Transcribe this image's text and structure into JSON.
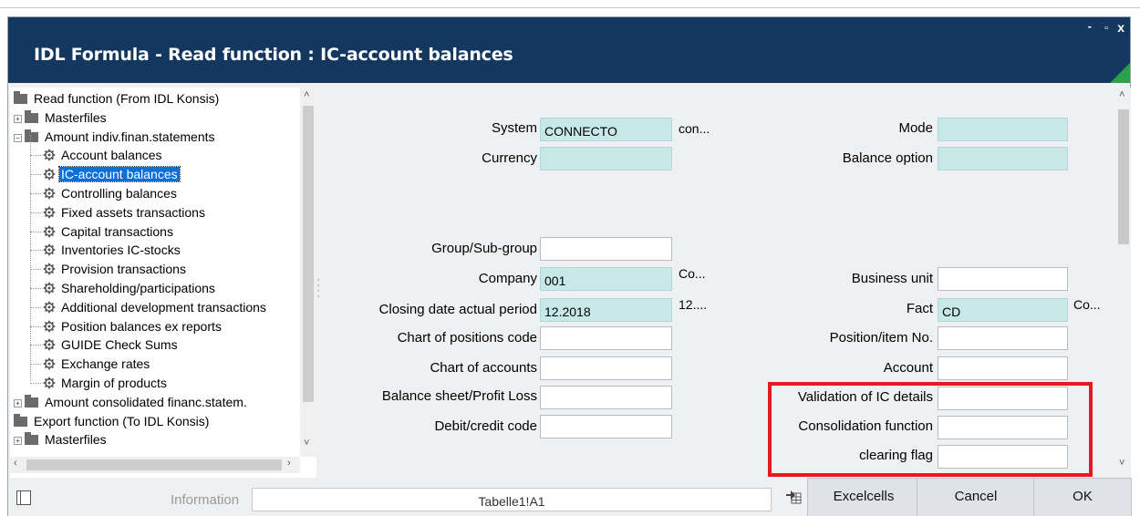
{
  "window": {
    "title": "IDL Formula  - Read function : IC-account balances",
    "controls": {
      "minimize": "-",
      "maximize": "▫",
      "close": "x"
    }
  },
  "tree": {
    "items": [
      {
        "label": "Read function (From IDL Konsis)",
        "kind": "folder",
        "expander": ""
      },
      {
        "label": "Masterfiles",
        "kind": "folder",
        "expander": "+"
      },
      {
        "label": "Amount indiv.finan.statements",
        "kind": "folder",
        "expander": "−"
      },
      {
        "label": "Account balances",
        "kind": "function"
      },
      {
        "label": "IC-account balances",
        "kind": "function",
        "selected": true
      },
      {
        "label": "Controlling balances",
        "kind": "function"
      },
      {
        "label": "Fixed assets transactions",
        "kind": "function"
      },
      {
        "label": "Capital transactions",
        "kind": "function"
      },
      {
        "label": "Inventories IC-stocks",
        "kind": "function"
      },
      {
        "label": "Provision transactions",
        "kind": "function"
      },
      {
        "label": "Shareholding/participations",
        "kind": "function"
      },
      {
        "label": "Additional development transactions",
        "kind": "function"
      },
      {
        "label": "Position balances ex reports",
        "kind": "function"
      },
      {
        "label": "GUIDE Check Sums",
        "kind": "function"
      },
      {
        "label": "Exchange rates",
        "kind": "function"
      },
      {
        "label": "Margin of products",
        "kind": "function"
      },
      {
        "label": "Amount consolidated financ.statem.",
        "kind": "folder",
        "expander": "+"
      },
      {
        "label": "Export function (To IDL Konsis)",
        "kind": "folder",
        "expander": ""
      },
      {
        "label": "Masterfiles",
        "kind": "folder",
        "expander": "+"
      }
    ]
  },
  "form": {
    "system": {
      "label": "System",
      "value": "CONNECTO",
      "desc": "con..."
    },
    "currency": {
      "label": "Currency",
      "value": ""
    },
    "mode": {
      "label": "Mode",
      "value": ""
    },
    "balance_option": {
      "label": "Balance option",
      "value": ""
    },
    "group": {
      "label": "Group/Sub-group",
      "value": ""
    },
    "company": {
      "label": "Company",
      "value": "001",
      "desc": "Co..."
    },
    "business_unit": {
      "label": "Business unit",
      "value": ""
    },
    "closing_date": {
      "label": "Closing date actual period",
      "value": "12.2018",
      "desc": "12...."
    },
    "fact": {
      "label": "Fact",
      "value": "CD",
      "desc": "Co..."
    },
    "chart_positions": {
      "label": "Chart of positions code",
      "value": ""
    },
    "position_item": {
      "label": "Position/item No.",
      "value": ""
    },
    "chart_accounts": {
      "label": "Chart of accounts",
      "value": ""
    },
    "account": {
      "label": "Account",
      "value": ""
    },
    "balance_sheet": {
      "label": "Balance sheet/Profit  Loss",
      "value": ""
    },
    "validation_ic": {
      "label": "Validation of IC details",
      "value": ""
    },
    "debit_credit": {
      "label": "Debit/credit code",
      "value": ""
    },
    "consolidation": {
      "label": "Consolidation function",
      "value": ""
    },
    "clearing_flag": {
      "label": "clearing flag",
      "value": ""
    }
  },
  "bottom": {
    "info_label": "Information",
    "info_value": "Tabelle1!A1",
    "excelcells": "Excelcells",
    "cancel": "Cancel",
    "ok": "OK"
  },
  "colors": {
    "titlebar": "#14375f",
    "accent_green": "#2aa24a",
    "highlight_red": "#e21b23",
    "field_teal": "#c6e9e8",
    "tree_selected": "#0a6fd8"
  }
}
